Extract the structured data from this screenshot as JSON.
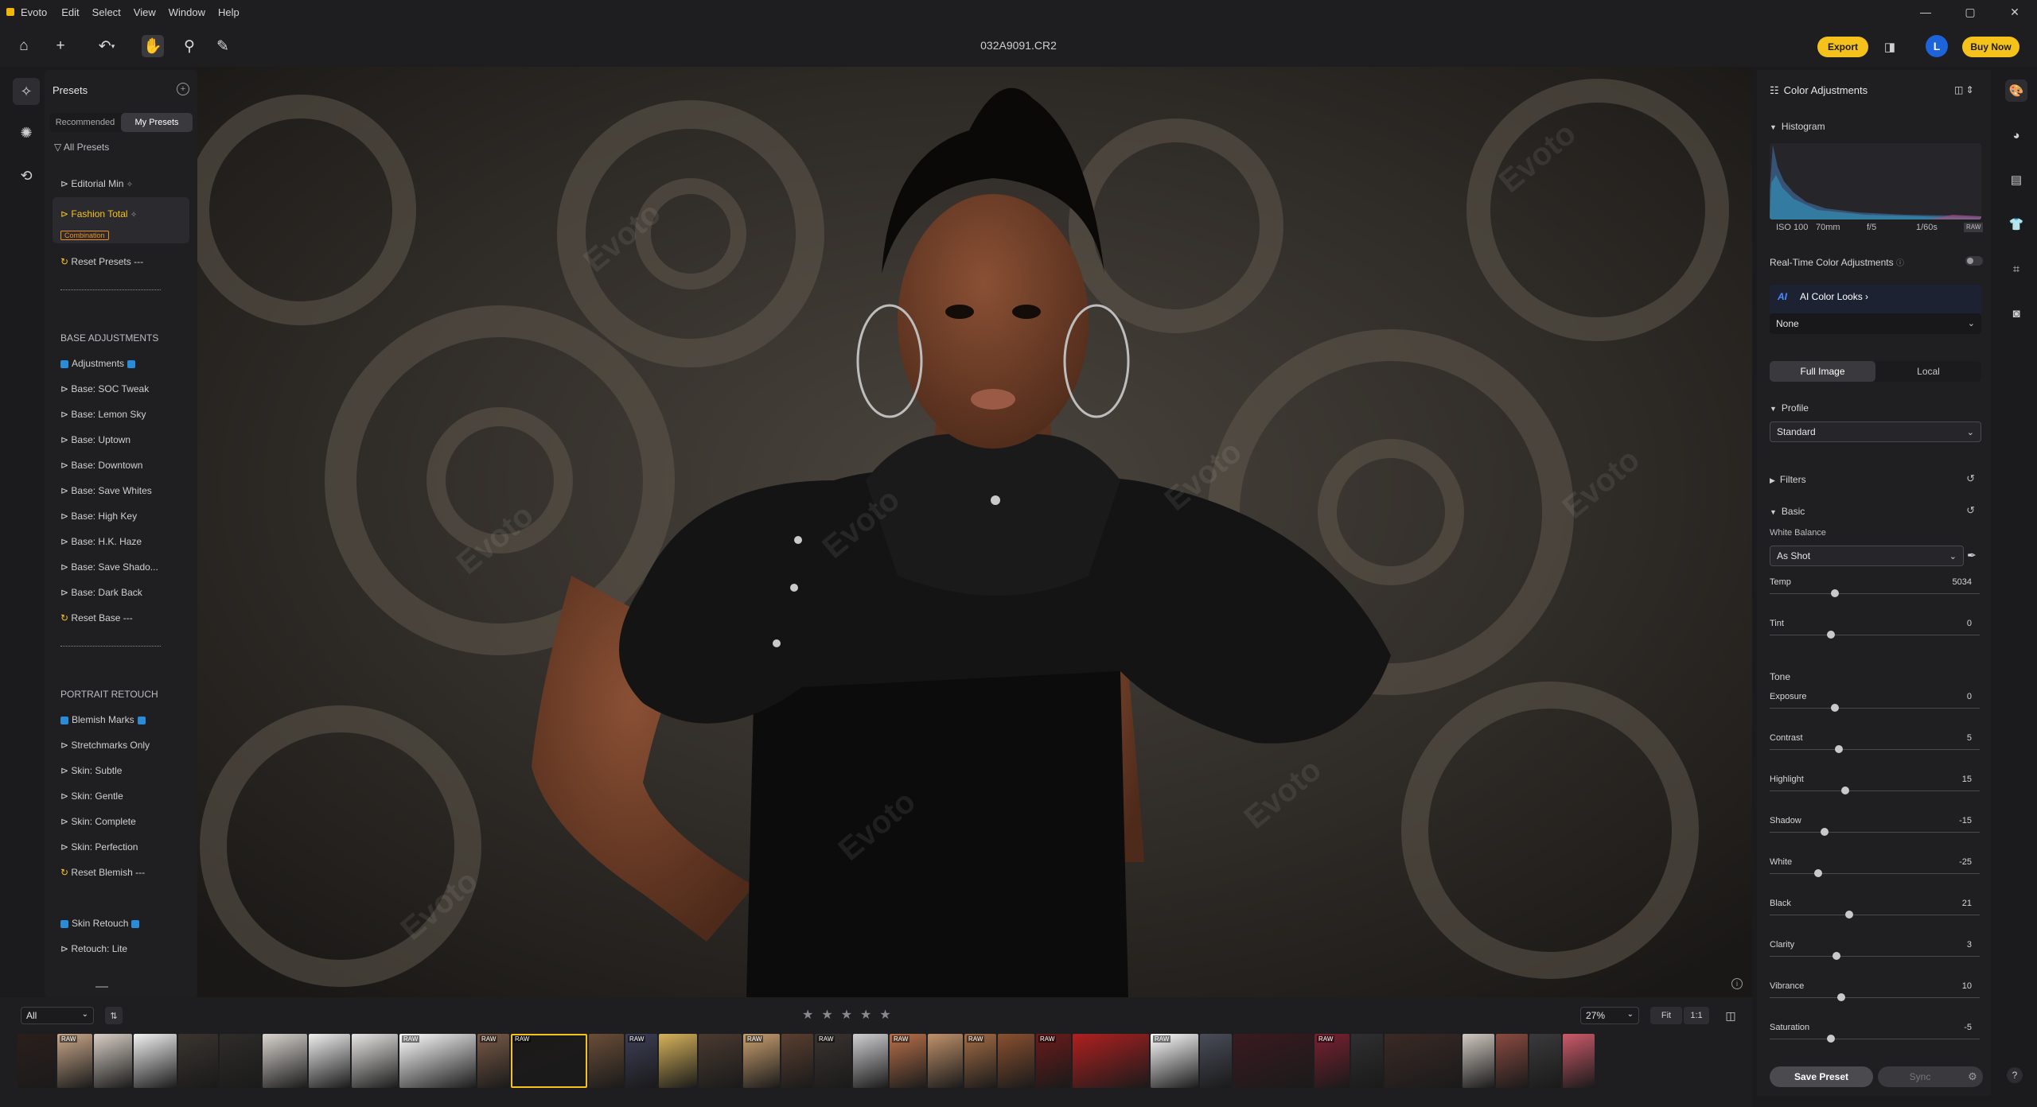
{
  "menubar": {
    "app": "Evoto",
    "items": [
      "Edit",
      "Select",
      "View",
      "Window",
      "Help"
    ]
  },
  "window_controls": {
    "minimize": "—",
    "maximize": "▢",
    "close": "✕"
  },
  "toolbar": {
    "filename": "032A9091.CR2",
    "export_label": "Export",
    "avatar_initial": "L",
    "buy_label": "Buy Now"
  },
  "presets": {
    "title": "Presets",
    "tabs": [
      "Recommended",
      "My Presets"
    ],
    "all_presets": "All Presets",
    "items": [
      {
        "label": "⊳ Editorial Min"
      },
      {
        "label": "⊳ Fashion Total"
      },
      {
        "badge": "Combination"
      },
      {
        "label": "Reset Presets ---"
      },
      {
        "label": "BASE ADJUSTMENTS"
      },
      {
        "label": "Adjustments"
      },
      {
        "label": "⊳ Base: SOC Tweak"
      },
      {
        "label": "⊳ Base: Lemon Sky"
      },
      {
        "label": "⊳ Base: Uptown"
      },
      {
        "label": "⊳ Base: Downtown"
      },
      {
        "label": "⊳ Base: Save Whites"
      },
      {
        "label": "⊳ Base: High Key"
      },
      {
        "label": "⊳ Base: H.K. Haze"
      },
      {
        "label": "⊳ Base: Save Shado..."
      },
      {
        "label": "⊳ Base: Dark Back"
      },
      {
        "label": "Reset Base ---"
      },
      {
        "label": "PORTRAIT RETOUCH"
      },
      {
        "label": "Blemish Marks"
      },
      {
        "label": "⊳ Stretchmarks Only"
      },
      {
        "label": "⊳ Skin: Subtle"
      },
      {
        "label": "⊳ Skin: Gentle"
      },
      {
        "label": "⊳ Skin: Complete"
      },
      {
        "label": "⊳ Skin: Perfection"
      },
      {
        "label": "Reset Blemish ---"
      },
      {
        "label": "Skin Retouch"
      },
      {
        "label": "⊳ Retouch: Lite"
      }
    ]
  },
  "watermark": "Evoto",
  "right_panel": {
    "title": "Color Adjustments",
    "histogram_label": "Histogram",
    "histogram_info": [
      "ISO 100",
      "70mm",
      "f/5",
      "1/60s",
      "RAW"
    ],
    "realtime_label": "Real-Time Color Adjustments",
    "ai_badge": "AI",
    "ai_looks_label": "AI Color Looks",
    "ai_looks_value": "None",
    "segment": [
      "Full Image",
      "Local"
    ],
    "profile_label": "Profile",
    "profile_value": "Standard",
    "filters_label": "Filters",
    "basic_label": "Basic",
    "wb_label": "White Balance",
    "wb_value": "As Shot",
    "tone_label": "Tone",
    "save_preset": "Save Preset",
    "sync": "Sync",
    "sliders": [
      {
        "label": "Temp",
        "value": "5034",
        "pos": 0.31
      },
      {
        "label": "Tint",
        "value": "0",
        "pos": 0.29
      },
      {
        "label": "Exposure",
        "value": "0",
        "pos": 0.31
      },
      {
        "label": "Contrast",
        "value": "5",
        "pos": 0.33
      },
      {
        "label": "Highlight",
        "value": "15",
        "pos": 0.36
      },
      {
        "label": "Shadow",
        "value": "-15",
        "pos": 0.26
      },
      {
        "label": "White",
        "value": "-25",
        "pos": 0.23
      },
      {
        "label": "Black",
        "value": "21",
        "pos": 0.38
      },
      {
        "label": "Clarity",
        "value": "3",
        "pos": 0.32
      },
      {
        "label": "Vibrance",
        "value": "10",
        "pos": 0.34
      },
      {
        "label": "Saturation",
        "value": "-5",
        "pos": 0.29
      }
    ]
  },
  "filmstrip": {
    "filter_value": "All",
    "zoom_value": "27%",
    "fit_label": "Fit",
    "one_label": "1:1",
    "raw_tag": "RAW"
  },
  "colors": {
    "accent": "#f5c21b",
    "highlight": "#f5c21b",
    "combination": "#f08d1e",
    "avatar": "#1d63d9"
  }
}
